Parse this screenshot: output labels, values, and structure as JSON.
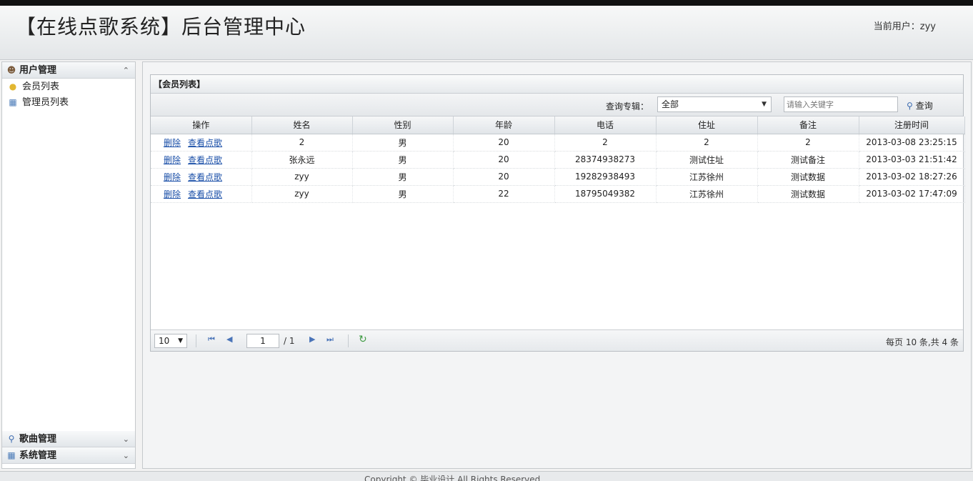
{
  "header": {
    "title": "【在线点歌系统】后台管理中心",
    "current_user_label": "当前用户：zyy"
  },
  "sidebar": {
    "sections": [
      {
        "label": "用户管理",
        "icon": "user-icon",
        "expanded": true,
        "items": [
          {
            "label": "会员列表",
            "icon": "lightbulb-icon"
          },
          {
            "label": "管理员列表",
            "icon": "grid-icon"
          }
        ]
      },
      {
        "label": "歌曲管理",
        "icon": "search-icon",
        "expanded": false
      },
      {
        "label": "系统管理",
        "icon": "grid-icon",
        "expanded": false
      }
    ]
  },
  "panel": {
    "title": "【会员列表】",
    "filter_label": "查询专辑：",
    "filter_value": "全部",
    "search_placeholder": "请输入关键字",
    "search_button": "查询"
  },
  "table": {
    "columns": [
      "操作",
      "姓名",
      "性别",
      "年龄",
      "电话",
      "住址",
      "备注",
      "注册时间"
    ],
    "action_delete": "删除",
    "action_view": "查看点歌",
    "rows": [
      {
        "name": "2",
        "gender": "男",
        "age": "20",
        "phone": "2",
        "address": "2",
        "note": "2",
        "reg_time": "2013-03-08 23:25:15"
      },
      {
        "name": "张永远",
        "gender": "男",
        "age": "20",
        "phone": "28374938273",
        "address": "测试住址",
        "note": "测试备注",
        "reg_time": "2013-03-03 21:51:42"
      },
      {
        "name": "zyy",
        "gender": "男",
        "age": "20",
        "phone": "19282938493",
        "address": "江苏徐州",
        "note": "测试数据",
        "reg_time": "2013-03-02 18:27:26"
      },
      {
        "name": "zyy",
        "gender": "男",
        "age": "22",
        "phone": "18795049382",
        "address": "江苏徐州",
        "note": "测试数据",
        "reg_time": "2013-03-02 17:47:09"
      }
    ]
  },
  "pager": {
    "page_size": "10",
    "page": "1",
    "total_pages": "/ 1",
    "info": "每页 10 条,共 4 条"
  },
  "footer": {
    "text": "Copyright © 毕业设计 All Rights Reserved"
  }
}
